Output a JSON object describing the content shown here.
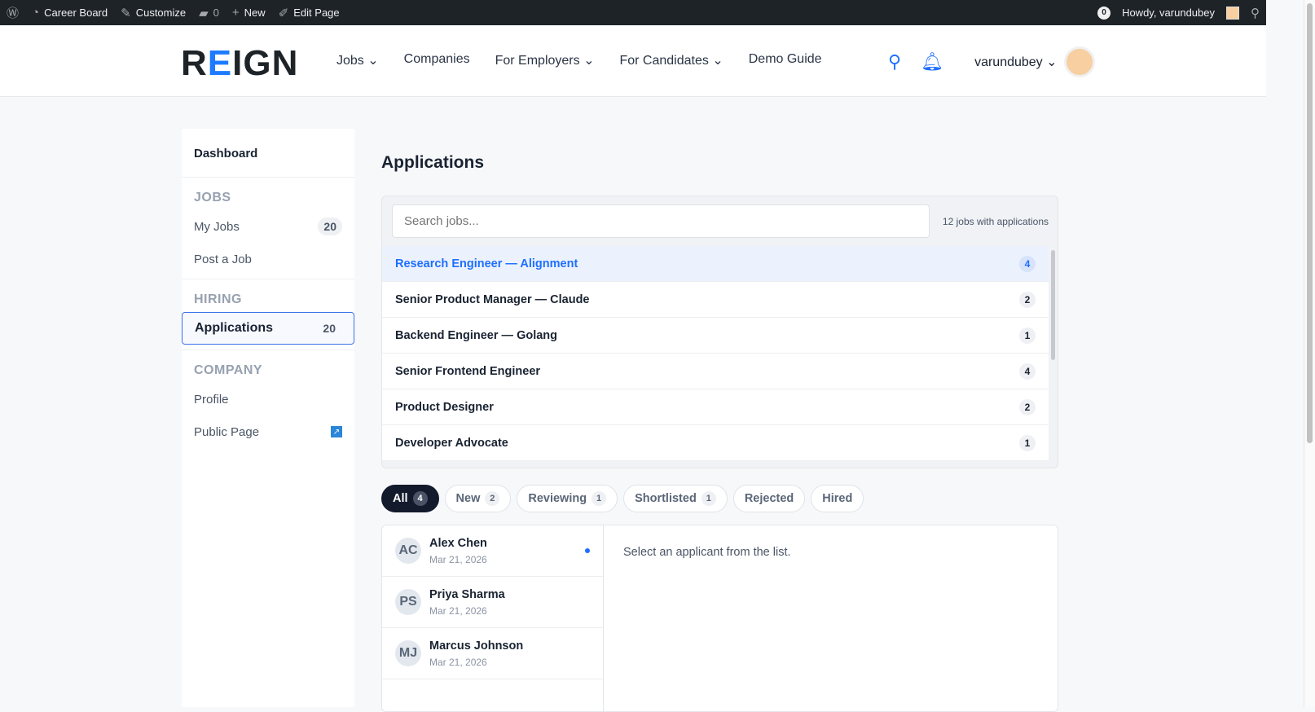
{
  "adminbar": {
    "site": "Career Board",
    "customize": "Customize",
    "comments": "0",
    "new": "New",
    "edit": "Edit Page",
    "notif": "0",
    "howdy": "Howdy, varundubey"
  },
  "header": {
    "logo_pre": "R",
    "logo_mid": "E",
    "logo_post": "IGN",
    "nav": [
      "Jobs",
      "Companies",
      "For Employers",
      "For Candidates",
      "Demo Guide"
    ],
    "user": "varundubey"
  },
  "sidebar": {
    "title": "Dashboard",
    "sections": {
      "jobs": "JOBS",
      "hiring": "HIRING",
      "company": "COMPANY"
    },
    "my_jobs": "My Jobs",
    "my_jobs_count": "20",
    "post_job": "Post a Job",
    "applications": "Applications",
    "applications_count": "20",
    "profile": "Profile",
    "public_page": "Public Page"
  },
  "main": {
    "title": "Applications",
    "search_placeholder": "Search jobs...",
    "jobs_count": "12 jobs with applications",
    "jobs": [
      {
        "title": "Research Engineer — Alignment",
        "count": "4"
      },
      {
        "title": "Senior Product Manager — Claude",
        "count": "2"
      },
      {
        "title": "Backend Engineer — Golang",
        "count": "1"
      },
      {
        "title": "Senior Frontend Engineer",
        "count": "4"
      },
      {
        "title": "Product Designer",
        "count": "2"
      },
      {
        "title": "Developer Advocate",
        "count": "1"
      }
    ],
    "filters": [
      {
        "label": "All",
        "count": "4"
      },
      {
        "label": "New",
        "count": "2"
      },
      {
        "label": "Reviewing",
        "count": "1"
      },
      {
        "label": "Shortlisted",
        "count": "1"
      },
      {
        "label": "Rejected"
      },
      {
        "label": "Hired"
      }
    ],
    "applicants": [
      {
        "initials": "AC",
        "name": "Alex Chen",
        "date": "Mar 21, 2026"
      },
      {
        "initials": "PS",
        "name": "Priya Sharma",
        "date": "Mar 21, 2026"
      },
      {
        "initials": "MJ",
        "name": "Marcus Johnson",
        "date": "Mar 21, 2026"
      }
    ],
    "empty": "Select an applicant from the list."
  }
}
